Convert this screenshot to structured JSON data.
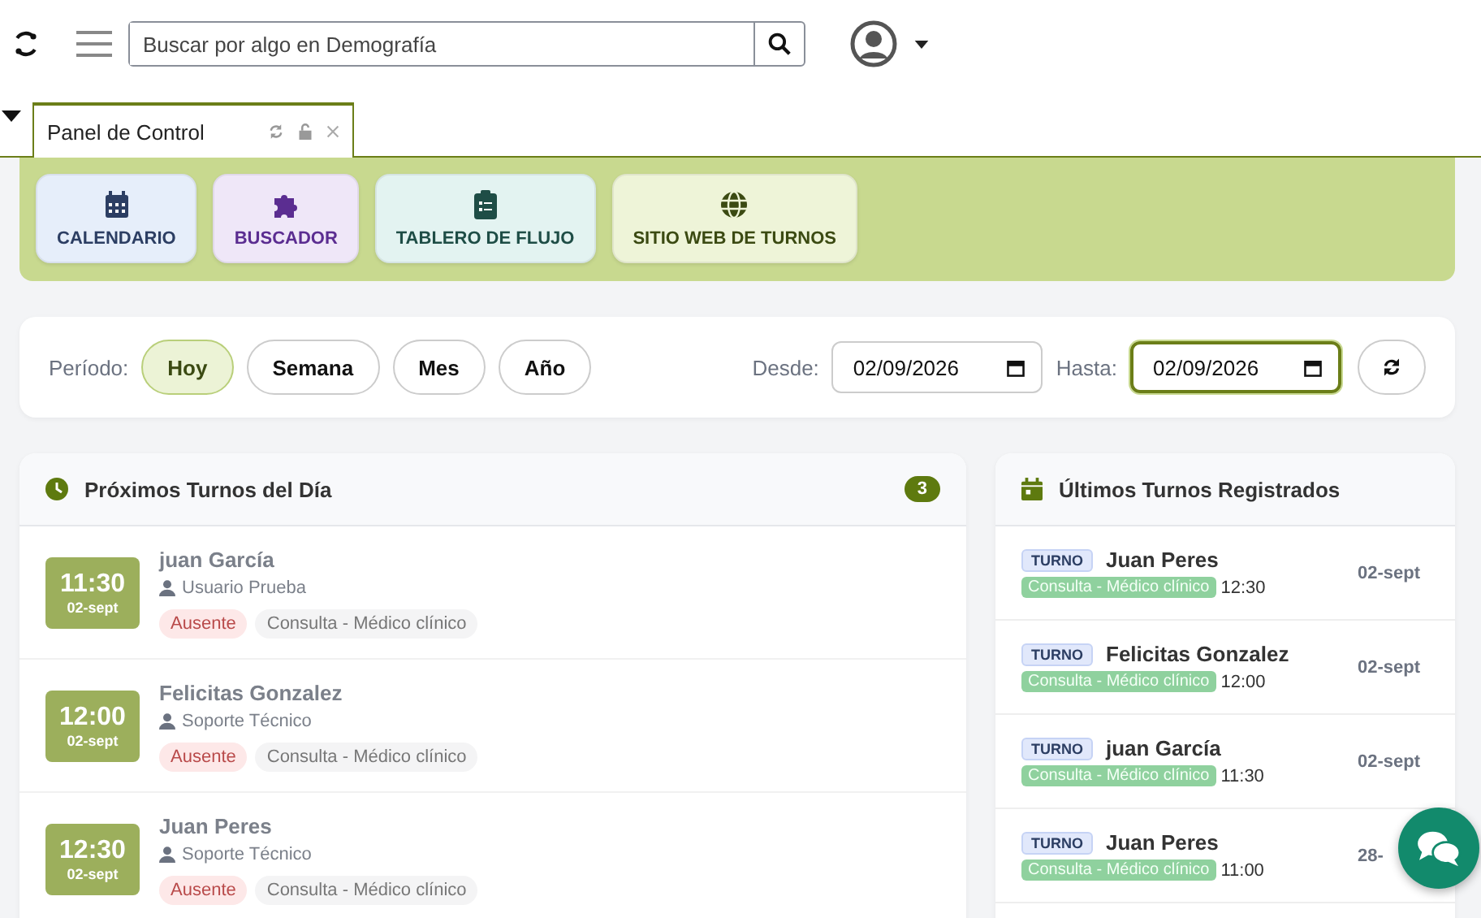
{
  "header": {
    "search": {
      "placeholder": "Buscar por algo en Demografía"
    }
  },
  "tabs": [
    {
      "label": "Panel de Control",
      "selected": true
    }
  ],
  "shortcuts": [
    {
      "label": "CALENDARIO",
      "kind": "calendar"
    },
    {
      "label": "BUSCADOR",
      "kind": "puzzle"
    },
    {
      "label": "TABLERO DE FLUJO",
      "kind": "clipboard"
    },
    {
      "label": "SITIO WEB DE TURNOS",
      "kind": "globe"
    }
  ],
  "filters": {
    "label": "Período:",
    "periods": [
      {
        "label": "Hoy",
        "selected": true
      },
      {
        "label": "Semana",
        "selected": false
      },
      {
        "label": "Mes",
        "selected": false
      },
      {
        "label": "Año",
        "selected": false
      }
    ],
    "from": {
      "label": "Desde:",
      "value": "02/09/2026",
      "focused": false
    },
    "to": {
      "label": "Hasta:",
      "value": "02/09/2026",
      "focused": true
    }
  },
  "upcoming": {
    "title": "Próximos Turnos del Día",
    "count": "3",
    "items": [
      {
        "time": "11:30",
        "date": "02-sept",
        "name": "juan García",
        "staff": "Usuario Prueba",
        "status": "Ausente",
        "service": "Consulta - Médico clínico"
      },
      {
        "time": "12:00",
        "date": "02-sept",
        "name": "Felicitas Gonzalez",
        "staff": "Soporte Técnico",
        "status": "Ausente",
        "service": "Consulta - Médico clínico"
      },
      {
        "time": "12:30",
        "date": "02-sept",
        "name": "Juan Peres",
        "staff": "Soporte Técnico",
        "status": "Ausente",
        "service": "Consulta - Médico clínico"
      }
    ]
  },
  "recent": {
    "title": "Últimos Turnos Registrados",
    "items": [
      {
        "tag": "TURNO",
        "name": "Juan Peres",
        "service": "Consulta - Médico clínico",
        "time": "12:30",
        "date": "02-sept"
      },
      {
        "tag": "TURNO",
        "name": "Felicitas Gonzalez",
        "service": "Consulta - Médico clínico",
        "time": "12:00",
        "date": "02-sept"
      },
      {
        "tag": "TURNO",
        "name": "juan García",
        "service": "Consulta - Médico clínico",
        "time": "11:30",
        "date": "02-sept"
      },
      {
        "tag": "TURNO",
        "name": "Juan Peres",
        "service": "Consulta - Médico clínico",
        "time": "11:00",
        "date": "28-"
      }
    ]
  }
}
